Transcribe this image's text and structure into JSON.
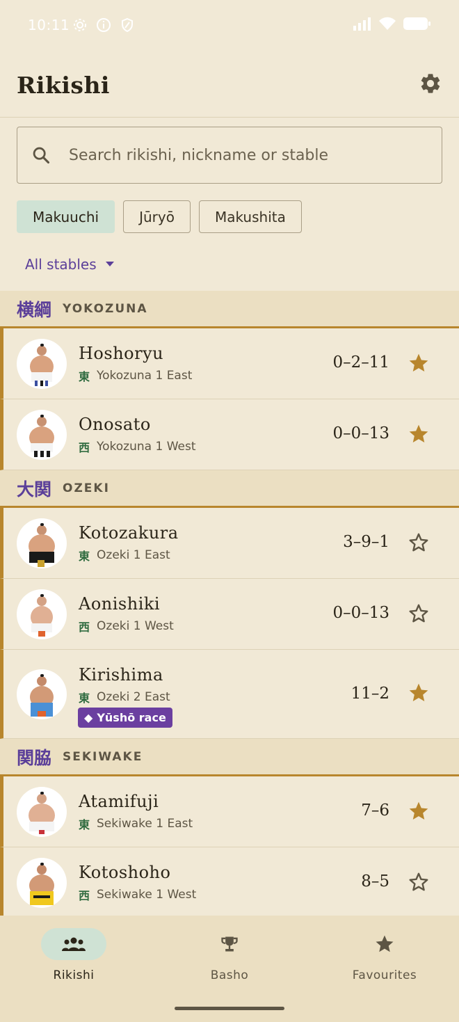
{
  "status_bar": {
    "time": "10:11"
  },
  "app": {
    "title": "Rikishi"
  },
  "search": {
    "placeholder": "Search rikishi, nickname or stable",
    "value": ""
  },
  "division_chips": [
    {
      "label": "Makuuchi",
      "selected": true
    },
    {
      "label": "Jūryō",
      "selected": false
    },
    {
      "label": "Makushita",
      "selected": false
    }
  ],
  "stable_filter": {
    "label": "All stables"
  },
  "ranks": [
    {
      "kanji": "横綱",
      "label": "YOKOZUNA",
      "rikishi": [
        {
          "name": "Hoshoryu",
          "side_kanji": "東",
          "rank": "Yokozuna 1 East",
          "record": "0–2–11",
          "favourite": true
        },
        {
          "name": "Onosato",
          "side_kanji": "西",
          "rank": "Yokozuna 1 West",
          "record": "0–0–13",
          "favourite": true
        }
      ]
    },
    {
      "kanji": "大関",
      "label": "OZEKI",
      "rikishi": [
        {
          "name": "Kotozakura",
          "side_kanji": "東",
          "rank": "Ozeki 1 East",
          "record": "3–9–1",
          "favourite": false
        },
        {
          "name": "Aonishiki",
          "side_kanji": "西",
          "rank": "Ozeki 1 West",
          "record": "0–0–13",
          "favourite": false
        },
        {
          "name": "Kirishima",
          "side_kanji": "東",
          "rank": "Ozeki 2 East",
          "record": "11–2",
          "favourite": true,
          "badge": "Yūshō race"
        }
      ]
    },
    {
      "kanji": "関脇",
      "label": "SEKIWAKE",
      "rikishi": [
        {
          "name": "Atamifuji",
          "side_kanji": "東",
          "rank": "Sekiwake 1 East",
          "record": "7–6",
          "favourite": true
        },
        {
          "name": "Kotoshoho",
          "side_kanji": "西",
          "rank": "Sekiwake 1 West",
          "record": "8–5",
          "favourite": false
        }
      ]
    }
  ],
  "bottom_nav": [
    {
      "label": "Rikishi",
      "icon": "group-icon",
      "active": true
    },
    {
      "label": "Basho",
      "icon": "trophy-icon",
      "active": false
    },
    {
      "label": "Favourites",
      "icon": "star-icon",
      "active": false
    }
  ],
  "colors": {
    "accent_gold": "#b8862d",
    "accent_purple": "#5b3f99",
    "selected_chip": "#cfe2d4",
    "badge": "#6b3fa0"
  }
}
